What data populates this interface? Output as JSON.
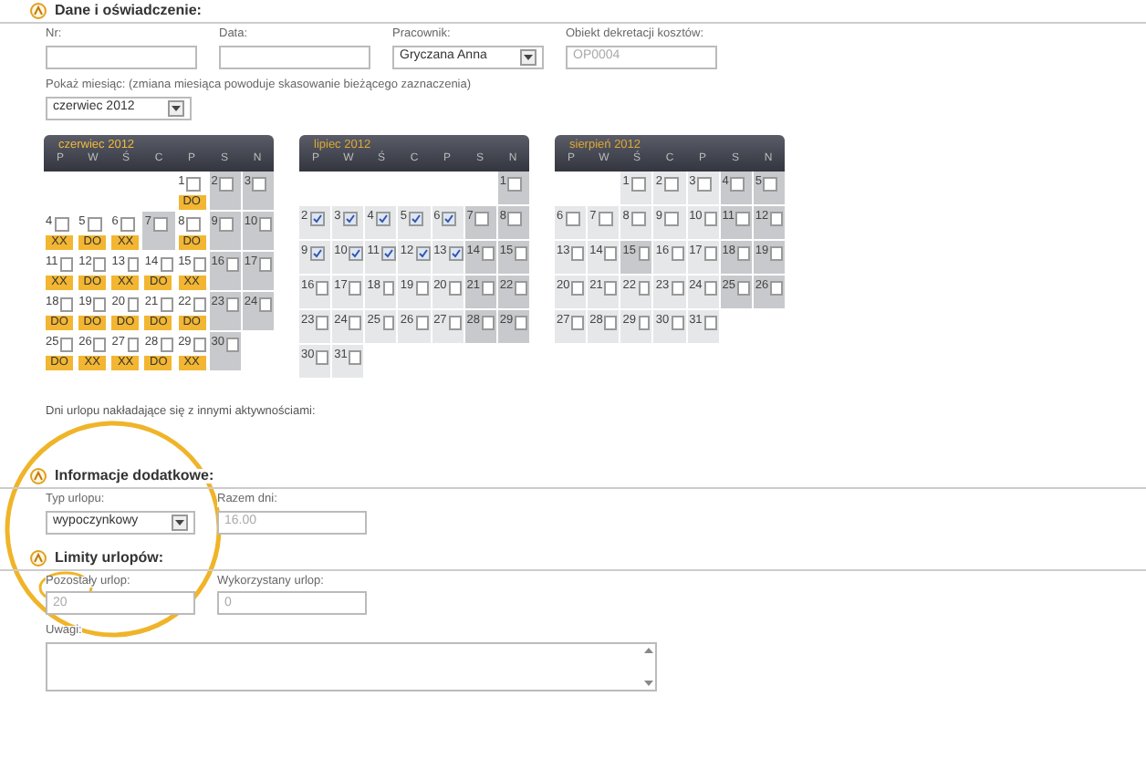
{
  "section_main": {
    "title": "Dane i oświadczenie:"
  },
  "fields": [
    {
      "label": "Nr:",
      "kind": "text"
    },
    {
      "label": "Data:",
      "kind": "text"
    },
    {
      "label": "Pracownik:",
      "kind": "select",
      "value": "Gryczana Anna"
    },
    {
      "label": "Obiekt dekretacji kosztów:",
      "kind": "readonly",
      "value": "OP0004"
    }
  ],
  "month_picker": {
    "label": "Pokaż miesiąc: (zmiana miesiąca powoduje skasowanie bieżącego zaznaczenia)",
    "value": "czerwiec 2012"
  },
  "calendars": [
    {
      "title": "czerwiec 2012",
      "selected": true,
      "weekdays": [
        "P",
        "W",
        "Ś",
        "C",
        "P",
        "S",
        "N"
      ],
      "days": [
        {
          "kind": "blank"
        },
        {
          "kind": "blank"
        },
        {
          "kind": "blank"
        },
        {
          "kind": "blank"
        },
        {
          "kind": "day",
          "label": "1",
          "checked": false,
          "free": false,
          "tag": "DO"
        },
        {
          "kind": "day",
          "label": "2",
          "checked": false,
          "free": true
        },
        {
          "kind": "day",
          "label": "3",
          "checked": false,
          "free": true
        },
        {
          "kind": "day",
          "label": "4",
          "checked": false,
          "free": false,
          "tag": "XX"
        },
        {
          "kind": "day",
          "label": "5",
          "checked": false,
          "free": false,
          "tag": "DO"
        },
        {
          "kind": "day",
          "label": "6",
          "checked": false,
          "free": false,
          "tag": "XX"
        },
        {
          "kind": "day",
          "label": "7",
          "checked": false,
          "free": true
        },
        {
          "kind": "day",
          "label": "8",
          "checked": false,
          "free": false,
          "tag": "DO"
        },
        {
          "kind": "day",
          "label": "9",
          "checked": false,
          "free": true
        },
        {
          "kind": "day",
          "label": "10",
          "checked": false,
          "free": true
        },
        {
          "kind": "day",
          "label": "11",
          "checked": false,
          "free": false,
          "tag": "XX"
        },
        {
          "kind": "day",
          "label": "12",
          "checked": false,
          "free": false,
          "tag": "DO"
        },
        {
          "kind": "day",
          "label": "13",
          "checked": false,
          "free": false,
          "tag": "XX"
        },
        {
          "kind": "day",
          "label": "14",
          "checked": false,
          "free": false,
          "tag": "DO"
        },
        {
          "kind": "day",
          "label": "15",
          "checked": false,
          "free": false,
          "tag": "XX"
        },
        {
          "kind": "day",
          "label": "16",
          "checked": false,
          "free": true
        },
        {
          "kind": "day",
          "label": "17",
          "checked": false,
          "free": true
        },
        {
          "kind": "day",
          "label": "18",
          "checked": false,
          "free": false,
          "tag": "DO"
        },
        {
          "kind": "day",
          "label": "19",
          "checked": false,
          "free": false,
          "tag": "DO"
        },
        {
          "kind": "day",
          "label": "20",
          "checked": false,
          "free": false,
          "tag": "DO"
        },
        {
          "kind": "day",
          "label": "21",
          "checked": false,
          "free": false,
          "tag": "DO"
        },
        {
          "kind": "day",
          "label": "22",
          "checked": false,
          "free": false,
          "tag": "DO"
        },
        {
          "kind": "day",
          "label": "23",
          "checked": false,
          "free": true
        },
        {
          "kind": "day",
          "label": "24",
          "checked": false,
          "free": true
        },
        {
          "kind": "day",
          "label": "25",
          "checked": false,
          "free": false,
          "tag": "DO"
        },
        {
          "kind": "day",
          "label": "26",
          "checked": false,
          "free": false,
          "tag": "XX"
        },
        {
          "kind": "day",
          "label": "27",
          "checked": false,
          "free": false,
          "tag": "XX"
        },
        {
          "kind": "day",
          "label": "28",
          "checked": false,
          "free": false,
          "tag": "DO"
        },
        {
          "kind": "day",
          "label": "29",
          "checked": false,
          "free": false,
          "tag": "XX"
        },
        {
          "kind": "day",
          "label": "30",
          "checked": false,
          "free": true
        }
      ]
    },
    {
      "title": "lipiec 2012",
      "selected": false,
      "weekdays": [
        "P",
        "W",
        "Ś",
        "C",
        "P",
        "S",
        "N"
      ],
      "days": [
        {
          "kind": "blank"
        },
        {
          "kind": "blank"
        },
        {
          "kind": "blank"
        },
        {
          "kind": "blank"
        },
        {
          "kind": "blank"
        },
        {
          "kind": "blank"
        },
        {
          "kind": "day",
          "label": "1",
          "checked": false,
          "free": true
        },
        {
          "kind": "day",
          "label": "2",
          "checked": true,
          "free": false
        },
        {
          "kind": "day",
          "label": "3",
          "checked": true,
          "free": false
        },
        {
          "kind": "day",
          "label": "4",
          "checked": true,
          "free": false
        },
        {
          "kind": "day",
          "label": "5",
          "checked": true,
          "free": false
        },
        {
          "kind": "day",
          "label": "6",
          "checked": true,
          "free": false
        },
        {
          "kind": "day",
          "label": "7",
          "checked": false,
          "free": true
        },
        {
          "kind": "day",
          "label": "8",
          "checked": false,
          "free": true
        },
        {
          "kind": "day",
          "label": "9",
          "checked": true,
          "free": false
        },
        {
          "kind": "day",
          "label": "10",
          "checked": true,
          "free": false
        },
        {
          "kind": "day",
          "label": "11",
          "checked": true,
          "free": false
        },
        {
          "kind": "day",
          "label": "12",
          "checked": true,
          "free": false
        },
        {
          "kind": "day",
          "label": "13",
          "checked": true,
          "free": false
        },
        {
          "kind": "day",
          "label": "14",
          "checked": false,
          "free": true
        },
        {
          "kind": "day",
          "label": "15",
          "checked": false,
          "free": true
        },
        {
          "kind": "day",
          "label": "16",
          "checked": false,
          "free": false
        },
        {
          "kind": "day",
          "label": "17",
          "checked": false,
          "free": false
        },
        {
          "kind": "day",
          "label": "18",
          "checked": false,
          "free": false
        },
        {
          "kind": "day",
          "label": "19",
          "checked": false,
          "free": false
        },
        {
          "kind": "day",
          "label": "20",
          "checked": false,
          "free": false
        },
        {
          "kind": "day",
          "label": "21",
          "checked": false,
          "free": true
        },
        {
          "kind": "day",
          "label": "22",
          "checked": false,
          "free": true
        },
        {
          "kind": "day",
          "label": "23",
          "checked": false,
          "free": false
        },
        {
          "kind": "day",
          "label": "24",
          "checked": false,
          "free": false
        },
        {
          "kind": "day",
          "label": "25",
          "checked": false,
          "free": false
        },
        {
          "kind": "day",
          "label": "26",
          "checked": false,
          "free": false
        },
        {
          "kind": "day",
          "label": "27",
          "checked": false,
          "free": false
        },
        {
          "kind": "day",
          "label": "28",
          "checked": false,
          "free": true
        },
        {
          "kind": "day",
          "label": "29",
          "checked": false,
          "free": true
        },
        {
          "kind": "day",
          "label": "30",
          "checked": false,
          "free": false
        },
        {
          "kind": "day",
          "label": "31",
          "checked": false,
          "free": false
        }
      ]
    },
    {
      "title": "sierpień 2012",
      "selected": false,
      "weekdays": [
        "P",
        "W",
        "Ś",
        "C",
        "P",
        "S",
        "N"
      ],
      "days": [
        {
          "kind": "blank"
        },
        {
          "kind": "blank"
        },
        {
          "kind": "day",
          "label": "1",
          "checked": false,
          "free": false
        },
        {
          "kind": "day",
          "label": "2",
          "checked": false,
          "free": false
        },
        {
          "kind": "day",
          "label": "3",
          "checked": false,
          "free": false
        },
        {
          "kind": "day",
          "label": "4",
          "checked": false,
          "free": true
        },
        {
          "kind": "day",
          "label": "5",
          "checked": false,
          "free": true
        },
        {
          "kind": "day",
          "label": "6",
          "checked": false,
          "free": false
        },
        {
          "kind": "day",
          "label": "7",
          "checked": false,
          "free": false
        },
        {
          "kind": "day",
          "label": "8",
          "checked": false,
          "free": false
        },
        {
          "kind": "day",
          "label": "9",
          "checked": false,
          "free": false
        },
        {
          "kind": "day",
          "label": "10",
          "checked": false,
          "free": false
        },
        {
          "kind": "day",
          "label": "11",
          "checked": false,
          "free": true
        },
        {
          "kind": "day",
          "label": "12",
          "checked": false,
          "free": true
        },
        {
          "kind": "day",
          "label": "13",
          "checked": false,
          "free": false
        },
        {
          "kind": "day",
          "label": "14",
          "checked": false,
          "free": false
        },
        {
          "kind": "day",
          "label": "15",
          "checked": false,
          "free": true
        },
        {
          "kind": "day",
          "label": "16",
          "checked": false,
          "free": false
        },
        {
          "kind": "day",
          "label": "17",
          "checked": false,
          "free": false
        },
        {
          "kind": "day",
          "label": "18",
          "checked": false,
          "free": true
        },
        {
          "kind": "day",
          "label": "19",
          "checked": false,
          "free": true
        },
        {
          "kind": "day",
          "label": "20",
          "checked": false,
          "free": false
        },
        {
          "kind": "day",
          "label": "21",
          "checked": false,
          "free": false
        },
        {
          "kind": "day",
          "label": "22",
          "checked": false,
          "free": false
        },
        {
          "kind": "day",
          "label": "23",
          "checked": false,
          "free": false
        },
        {
          "kind": "day",
          "label": "24",
          "checked": false,
          "free": false
        },
        {
          "kind": "day",
          "label": "25",
          "checked": false,
          "free": true
        },
        {
          "kind": "day",
          "label": "26",
          "checked": false,
          "free": true
        },
        {
          "kind": "day",
          "label": "27",
          "checked": false,
          "free": false
        },
        {
          "kind": "day",
          "label": "28",
          "checked": false,
          "free": false
        },
        {
          "kind": "day",
          "label": "29",
          "checked": false,
          "free": false
        },
        {
          "kind": "day",
          "label": "30",
          "checked": false,
          "free": false
        },
        {
          "kind": "day",
          "label": "31",
          "checked": false,
          "free": false
        }
      ]
    }
  ],
  "overlap_note": "Dni urlopu nakładające się z innymi aktywnościami:",
  "section_info": {
    "title": "Informacje dodatkowe:",
    "fields": [
      {
        "label": "Typ urlopu:",
        "kind": "select",
        "value": "wypoczynkowy"
      },
      {
        "label": "Razem dni:",
        "kind": "readonly",
        "value": "16.00"
      }
    ]
  },
  "section_limits": {
    "title": "Limity urlopów:",
    "fields": [
      {
        "label": "Pozostały urlop:",
        "kind": "readonly",
        "value": "20"
      },
      {
        "label": "Wykorzystany urlop:",
        "kind": "readonly",
        "value": "0"
      }
    ]
  },
  "notes": {
    "label": "Uwagi:"
  }
}
